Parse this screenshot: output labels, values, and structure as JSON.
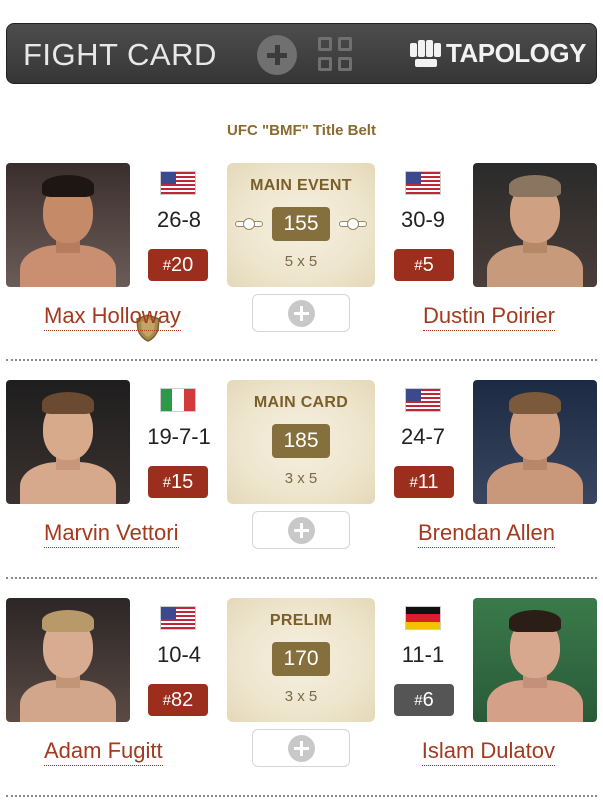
{
  "header": {
    "title": "FIGHT CARD",
    "logo_text": "TAPOLOGY",
    "icons": [
      "plus-circle-icon",
      "grid-icon",
      "tapology-logo"
    ]
  },
  "event": {
    "belt_title": "UFC \"BMF\" Title Belt"
  },
  "colors": {
    "header_bg": "#3f3f3f",
    "accent_brown": "#85703d",
    "rank_red": "#9b2e1c",
    "rank_gray": "#555555",
    "name_link": "#a33a1f"
  },
  "fights": [
    {
      "label": "MAIN EVENT",
      "weight": "155",
      "rounds": "5 x 5",
      "left": {
        "name": "Max Holloway",
        "record": "26-8",
        "rank_hash": "#",
        "rank": "20",
        "flag": "US",
        "rank_style": "red"
      },
      "right": {
        "name": "Dustin Poirier",
        "record": "30-9",
        "rank_hash": "#",
        "rank": "5",
        "flag": "US",
        "rank_style": "red"
      }
    },
    {
      "label": "MAIN CARD",
      "weight": "185",
      "rounds": "3 x 5",
      "left": {
        "name": "Marvin Vettori",
        "record": "19-7-1",
        "rank_hash": "#",
        "rank": "15",
        "flag": "IT",
        "rank_style": "red"
      },
      "right": {
        "name": "Brendan Allen",
        "record": "24-7",
        "rank_hash": "#",
        "rank": "11",
        "flag": "US",
        "rank_style": "red"
      }
    },
    {
      "label": "PRELIM",
      "weight": "170",
      "rounds": "3 x 5",
      "left": {
        "name": "Adam Fugitt",
        "record": "10-4",
        "rank_hash": "#",
        "rank": "82",
        "flag": "US",
        "rank_style": "red"
      },
      "right": {
        "name": "Islam Dulatov",
        "record": "11-1",
        "rank_hash": "#",
        "rank": "6",
        "flag": "DE",
        "rank_style": "gray"
      }
    }
  ]
}
